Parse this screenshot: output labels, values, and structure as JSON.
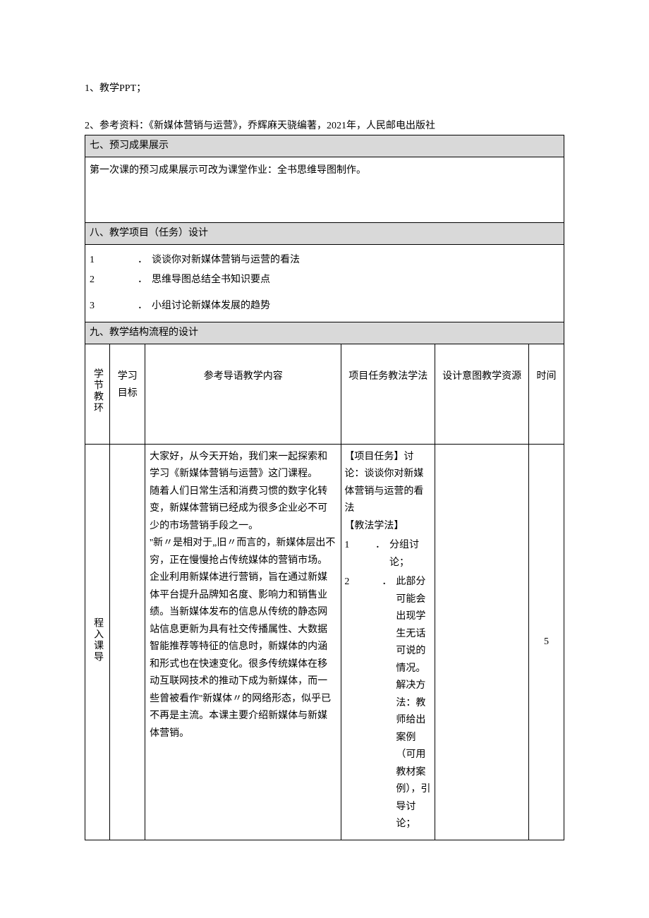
{
  "preamble": {
    "line1": "1、教学PPT；",
    "line2": "2、参考资料：《新媒体营销与运营》，乔辉麻天骁编著，2021年，人民邮电出版社"
  },
  "sections": {
    "s7": {
      "title": "七、预习成果展示",
      "body": "第一次课的预习成果展示可改为课堂作业：全书思维导图制作。"
    },
    "s8": {
      "title": "八、教学项目（任务）设计",
      "items": [
        {
          "n": "1",
          "text": "谈谈你对新媒体营销与运营的看法"
        },
        {
          "n": "2",
          "text": "思维导图总结全书知识要点"
        },
        {
          "n": "3",
          "text": "小组讨论新媒体发展的趋势"
        }
      ]
    },
    "s9": {
      "title": "九、教学结构流程的设计"
    }
  },
  "grid": {
    "headers": {
      "c1": "学节教环",
      "c2": "学习目标",
      "c3": "参考导语教学内容",
      "c4": "项目任务教法学法",
      "c5": "设计意图教学资源",
      "c6": "时间"
    },
    "rows": [
      {
        "c1": "程入课导",
        "c2": "",
        "c3": "大家好，从今天开始，我们来一起探索和学习《新媒体营销与运营》这门课程。\n随着人们日常生活和消费习惯的数字化转变，新媒体营销已经成为很多企业必不可少的市场营销手段之一。\n''新〃是相对于„旧〃而言的，新媒体层出不穷，正在慢慢抢占传统媒体的营销市场。企业利用新媒体进行营销，旨在通过新媒体平台提升品牌知名度、影响力和销售业绩。当新媒体发布的信息从传统的静态网站信息更新为具有社交传播属性、大数据智能推荐等特征的信息时，新媒体的内涵和形式也在快速变化。很多传统媒体在移动互联网技术的推动下成为新媒体，而一些曾被看作''新媒体〃的网络形态，似乎已不再是主流。本课主要介绍新媒体与新媒体营销。",
        "c4_intro": "【项目任务】讨论：谈谈你对新媒体营销与运营的看法",
        "c4_method_label": "【教法学法】",
        "c4_items": [
          {
            "n": "1",
            "text": "分组讨论；"
          },
          {
            "n": "2",
            "text": "此部分可能会出现学生无话可说的情况。解决方法：教师给出案例（可用教材案例），引导讨论；"
          }
        ],
        "c5": "",
        "c6": "5"
      }
    ]
  }
}
